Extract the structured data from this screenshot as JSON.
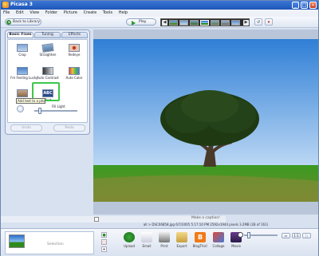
{
  "window": {
    "title": "Picasa 3",
    "min": "_",
    "max": "□",
    "close": "×"
  },
  "menu": [
    "File",
    "Edit",
    "View",
    "Folder",
    "Picture",
    "Create",
    "Tools",
    "Help"
  ],
  "toolbar": {
    "back_label": "Back to Library",
    "play_label": "Play",
    "prev": "◀",
    "next": "▶"
  },
  "tabs": [
    "Basic Fixes",
    "Tuning",
    "Effects"
  ],
  "fixes": [
    "Crop",
    "Straighten",
    "Redeye",
    "I'm Feeling Lucky",
    "Auto Contrast",
    "Auto Color",
    "Retouch",
    "Text"
  ],
  "tooltip": "Add text to a photo",
  "fill_light": {
    "label": "Fill Light",
    "value": 0.1
  },
  "undo_label": "Undo",
  "redo_label": "Redo",
  "caption_placeholder": "Make a caption!",
  "status_text": "all > DSC06858.jpg   6/7/2005 5:17:10 PM   2592x1944 pixels   3.2MB   (28 of 161)",
  "tray_label": "Selection",
  "actions": [
    "Upload",
    "Email",
    "Print",
    "Export",
    "BlogThis!",
    "Collage",
    "Movie"
  ],
  "colors": {
    "sky_top": "#2f7fd6",
    "sky_bottom": "#bcd8f4",
    "grass": "#2f8a1e",
    "highlight": "#3cc84a"
  }
}
